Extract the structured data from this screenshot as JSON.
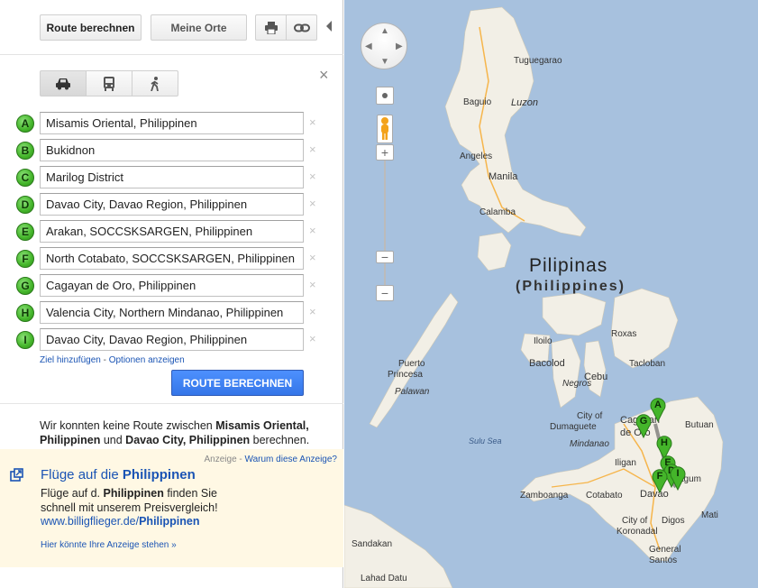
{
  "toolbar": {
    "route_label": "Route berechnen",
    "places_label": "Meine Orte",
    "print_icon": "printer-icon",
    "link_icon": "link-icon"
  },
  "modes": [
    "car-icon",
    "transit-icon",
    "walking-icon"
  ],
  "close_label": "×",
  "waypoints": [
    {
      "letter": "A",
      "value": "Misamis Oriental, Philippinen"
    },
    {
      "letter": "B",
      "value": "Bukidnon"
    },
    {
      "letter": "C",
      "value": "Marilog District"
    },
    {
      "letter": "D",
      "value": "Davao City, Davao Region, Philippinen"
    },
    {
      "letter": "E",
      "value": "Arakan, SOCCSKSARGEN, Philippinen"
    },
    {
      "letter": "F",
      "value": "North Cotabato, SOCCSKSARGEN, Philippinen"
    },
    {
      "letter": "G",
      "value": "Cagayan de Oro, Philippinen"
    },
    {
      "letter": "H",
      "value": "Valencia City, Northern Mindanao, Philippinen"
    },
    {
      "letter": "I",
      "value": "Davao City, Davao Region, Philippinen"
    }
  ],
  "remove_label": "×",
  "links": {
    "add_destination": "Ziel hinzufügen",
    "separator": " - ",
    "options": "Optionen anzeigen"
  },
  "route_button": "ROUTE BERECHNEN",
  "error": {
    "part1": "Wir konnten keine Route zwischen ",
    "from": "Misamis Oriental, Philippinen",
    "part2": " und ",
    "to": "Davao City, Philippinen",
    "part3": " berechnen."
  },
  "ad": {
    "label": "Anzeige",
    "sep": " - ",
    "why": "Warum diese Anzeige?",
    "title_prefix": "Flüge auf die ",
    "title_bold": "Philippinen",
    "text_prefix": "Flüge auf d. ",
    "text_bold": "Philippinen",
    "text_suffix": " finden Sie schnell mit unserem Preisvergleich!",
    "url_prefix": "www.billigflieger.de/",
    "url_bold": "Philippinen",
    "own_ad": "Hier könnte Ihre Anzeige stehen »"
  },
  "map": {
    "country": "Pilipinas",
    "country_en": "(Philippines)",
    "labels": [
      {
        "text": "Tuguegarao",
        "cls": "city"
      },
      {
        "text": "Baguio",
        "cls": "city"
      },
      {
        "text": "Luzon",
        "cls": "big italic"
      },
      {
        "text": "Angeles",
        "cls": "city"
      },
      {
        "text": "Manila",
        "cls": "big"
      },
      {
        "text": "Calamba",
        "cls": "city"
      },
      {
        "text": "Puerto",
        "cls": "city"
      },
      {
        "text": "Princesa",
        "cls": "city"
      },
      {
        "text": "Palawan",
        "cls": "city italic"
      },
      {
        "text": "Iloilo",
        "cls": "city"
      },
      {
        "text": "Bacolod",
        "cls": "big"
      },
      {
        "text": "Cebu",
        "cls": "big"
      },
      {
        "text": "Negros",
        "cls": "city italic"
      },
      {
        "text": "Tacloban",
        "cls": "city"
      },
      {
        "text": "Roxas",
        "cls": "city"
      },
      {
        "text": "Dumaguete",
        "cls": "city"
      },
      {
        "text": "City of",
        "cls": "city"
      },
      {
        "text": "Butuan",
        "cls": "city"
      },
      {
        "text": "Mindanao",
        "cls": "city italic"
      },
      {
        "text": "Iligan",
        "cls": "city"
      },
      {
        "text": "Cagayan",
        "cls": "big"
      },
      {
        "text": "de Oro",
        "cls": "big"
      },
      {
        "text": "Sulu Sea",
        "cls": "sea"
      },
      {
        "text": "Zamboanga",
        "cls": "city"
      },
      {
        "text": "Cotabato",
        "cls": "city"
      },
      {
        "text": "Davao",
        "cls": "big"
      },
      {
        "text": "Digos",
        "cls": "city"
      },
      {
        "text": "City of",
        "cls": "city"
      },
      {
        "text": "Koronadal",
        "cls": "city"
      },
      {
        "text": "General",
        "cls": "city"
      },
      {
        "text": "Santos",
        "cls": "city"
      },
      {
        "text": "Sandakan",
        "cls": "city"
      },
      {
        "text": "Lahad Datu",
        "cls": "city"
      },
      {
        "text": "Tagum",
        "cls": "city"
      },
      {
        "text": "Mati",
        "cls": "city"
      }
    ],
    "pins": [
      "A",
      "G",
      "H",
      "E",
      "D",
      "F",
      "I"
    ]
  },
  "colors": {
    "land": "#f2efe6",
    "water": "#a7c1de",
    "marker": "#44b52a",
    "accent": "#4d90fe",
    "link": "#1a54b4",
    "ad_bg": "#fff8e4"
  }
}
